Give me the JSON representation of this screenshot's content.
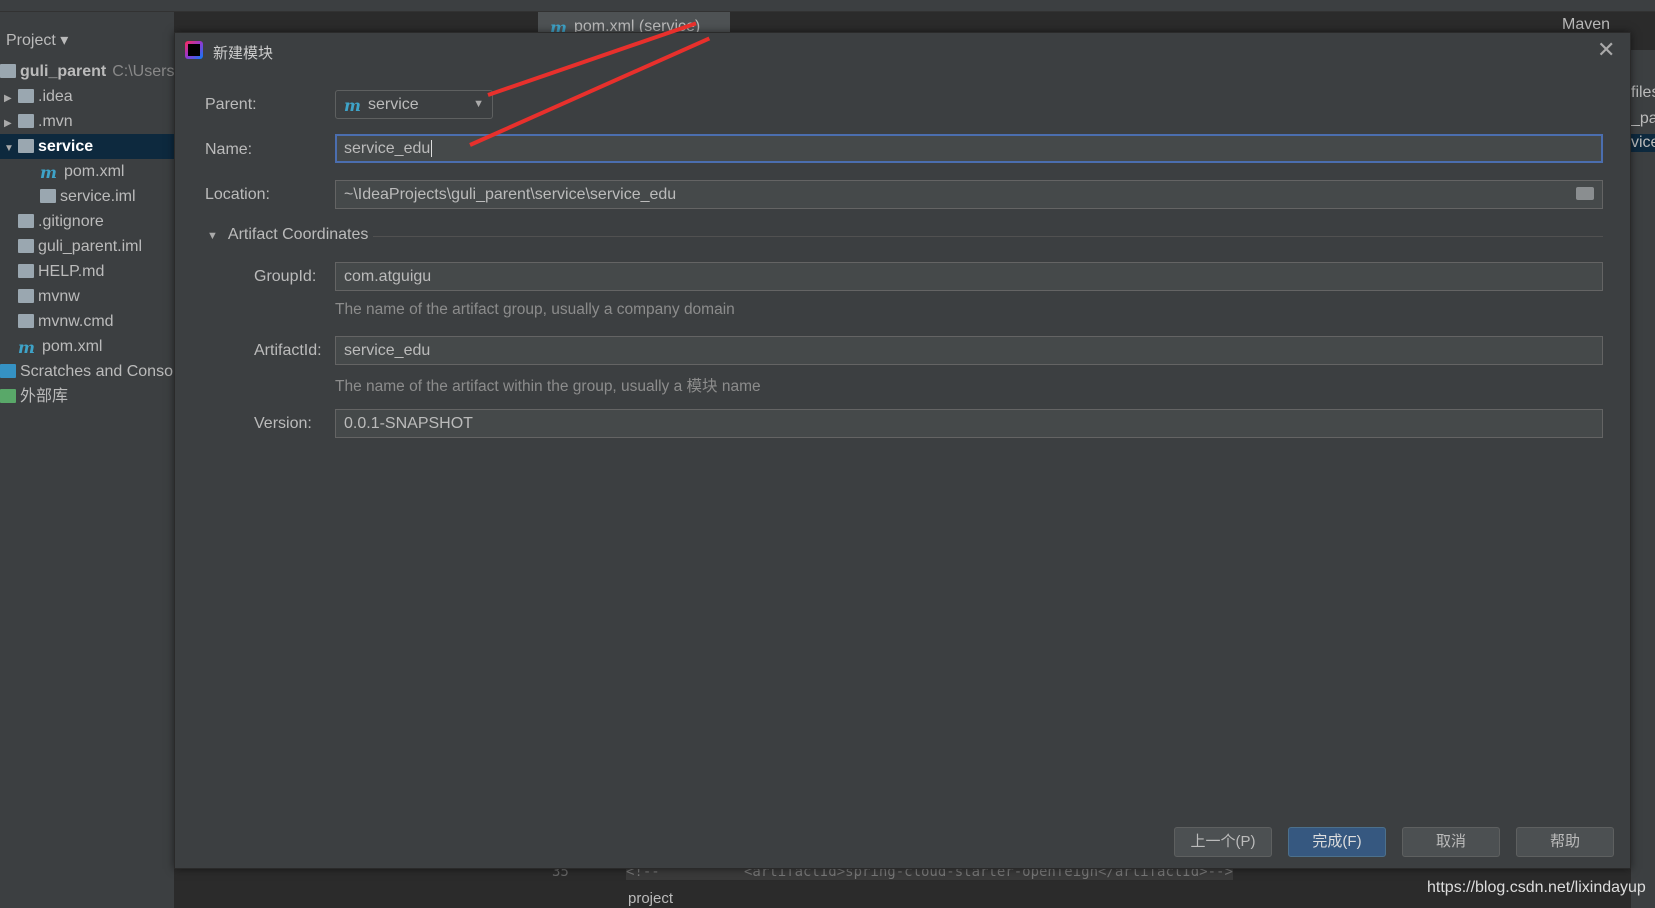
{
  "ide": {
    "project_label": "Project",
    "editor_tab": "pom.xml (service)",
    "maven_label": "Maven",
    "right_panel_items": [
      "files",
      "_pa",
      "vice"
    ],
    "editor_line_number": "35",
    "editor_code": "<!--          <artifactId>spring-cloud-starter-openfeign</artifactId>-->",
    "editor_breadcrumb": "project"
  },
  "tree": [
    {
      "label": "guli_parent",
      "extra": "C:\\Users\\",
      "icon": "module-folder-icon",
      "arrow": "",
      "level": 0,
      "bold": true
    },
    {
      "label": ".idea",
      "icon": "folder-icon",
      "arrow": "▶",
      "level": 0
    },
    {
      "label": ".mvn",
      "icon": "folder-icon",
      "arrow": "▶",
      "level": 0
    },
    {
      "label": "service",
      "icon": "module-folder-icon",
      "arrow": "▼",
      "level": 0,
      "selected": true
    },
    {
      "label": "pom.xml",
      "icon": "maven-icon",
      "level": 1
    },
    {
      "label": "service.iml",
      "icon": "iml-file-icon",
      "level": 1
    },
    {
      "label": ".gitignore",
      "icon": "gitignore-file-icon",
      "level": 0
    },
    {
      "label": "guli_parent.iml",
      "icon": "iml-file-icon",
      "level": 0
    },
    {
      "label": "HELP.md",
      "icon": "markdown-file-icon",
      "level": 0
    },
    {
      "label": "mvnw",
      "icon": "shell-file-icon",
      "level": 0
    },
    {
      "label": "mvnw.cmd",
      "icon": "text-file-icon",
      "level": 0
    },
    {
      "label": "pom.xml",
      "icon": "maven-icon",
      "level": 0
    },
    {
      "label": "Scratches and Consoles",
      "icon": "scratches-icon",
      "level": -1
    },
    {
      "label": "外部库",
      "icon": "library-icon",
      "level": -1
    }
  ],
  "dialog": {
    "title": "新建模块",
    "parent_label": "Parent:",
    "parent_value": "service",
    "name_label": "Name:",
    "name_value": "service_edu",
    "location_label": "Location:",
    "location_value": "~\\IdeaProjects\\guli_parent\\service\\service_edu",
    "section_title": "Artifact Coordinates",
    "groupid_label": "GroupId:",
    "groupid_value": "com.atguigu",
    "groupid_help": "The name of the artifact group, usually a company domain",
    "artifactid_label": "ArtifactId:",
    "artifactid_value": "service_edu",
    "artifactid_help": "The name of the artifact within the group, usually a 模块 name",
    "version_label": "Version:",
    "version_value": "0.0.1-SNAPSHOT",
    "buttons": {
      "previous": "上一个(P)",
      "finish": "完成(F)",
      "cancel": "取消",
      "help": "帮助"
    }
  },
  "annotation_color": "#e8302c",
  "watermark": "https://blog.csdn.net/lixindayup"
}
